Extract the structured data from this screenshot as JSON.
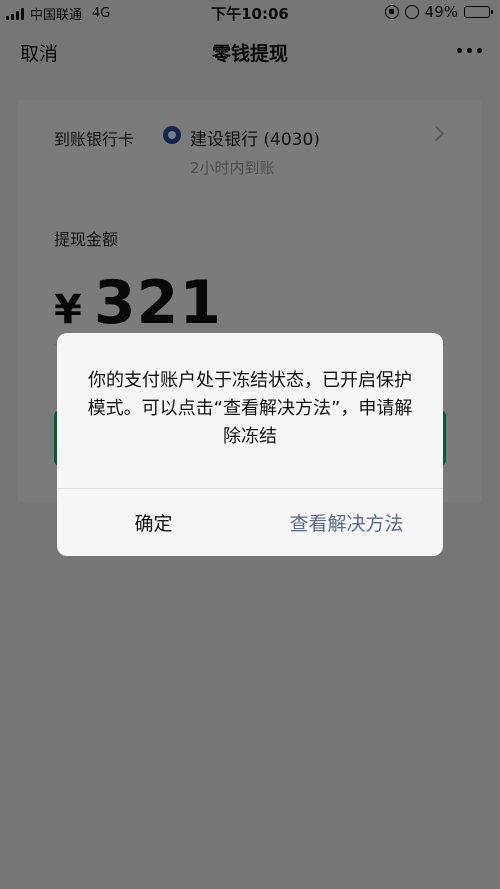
{
  "status_bar": {
    "carrier": "中国联通",
    "network": "4G",
    "time": "下午10:06",
    "battery_percent": "49%",
    "battery_level": 0.49
  },
  "nav": {
    "cancel_label": "取消",
    "title": "零钱提现"
  },
  "card": {
    "bank_label": "到账银行卡",
    "bank_name": "建设银行 (4030)",
    "arrive_time": "2小时内到账",
    "amount_label": "提现金额",
    "currency": "¥",
    "amount": "321"
  },
  "dialog": {
    "message": "你的支付账户处于冻结状态，已开启保护模式。可以点击“查看解决方法”，申请解除冻结",
    "ok_label": "确定",
    "view_label": "查看解决方法"
  },
  "colors": {
    "accent_green": "#07c160",
    "link_blue": "#576b95",
    "bank_blue": "#1b4fa0"
  }
}
